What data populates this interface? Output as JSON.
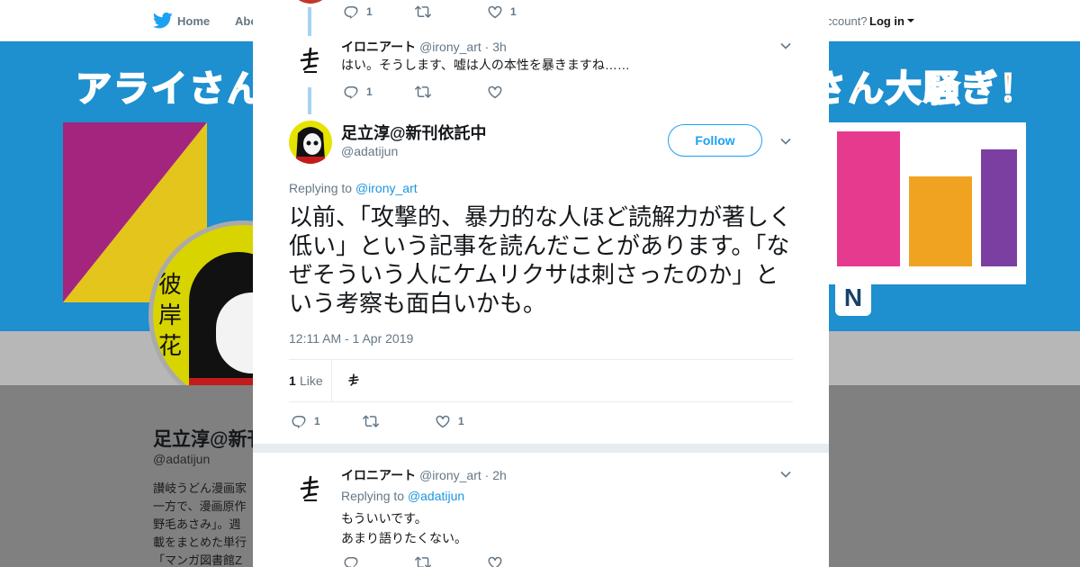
{
  "background": {
    "nav": {
      "home_label": "Home",
      "about_label": "Abo",
      "account_text": "ccount?",
      "login_label": "Log in"
    },
    "banner": {
      "title_left": "アライさんた",
      "title_right": "さん大騒ぎ！",
      "badge": "N"
    },
    "avatar_kanji": "彼岸花",
    "profile": {
      "name": "足立淳@新刊",
      "handle": "@adatijun",
      "bio": "讃岐うどん漫画家\n一方で、漫画原作\n野毛あさみ」。週\n載をまとめた単行\n「マンガ図書館Z"
    }
  },
  "modal": {
    "prev_tweet_top": {
      "reply_count": "1",
      "retweet_count": "",
      "like_count": "1"
    },
    "tweet_irony_1": {
      "name": "イロニアート",
      "handle": "@irony_art",
      "time": "· 3h",
      "text": "はい。そうします、嘘は人の本性を暴きますね……",
      "reply_count": "1",
      "retweet_count": "",
      "like_count": ""
    },
    "main_tweet": {
      "name": "足立淳@新刊依託中",
      "handle": "@adatijun",
      "follow_label": "Follow",
      "replying_prefix": "Replying to ",
      "replying_to": "@irony_art",
      "text": "以前、「攻撃的、暴力的な人ほど読解力が著しく低い」という記事を読んだことがあります。「なぜそういう人にケムリクサは刺さったのか」という考察も面白いかも。",
      "timestamp": "12:11 AM - 1 Apr 2019",
      "likes_number": "1",
      "likes_label": "Like",
      "reply_count": "1",
      "retweet_count": "",
      "like_count": "1"
    },
    "tweet_irony_2": {
      "name": "イロニアート",
      "handle": "@irony_art",
      "time": "· 2h",
      "replying_prefix": "Replying to ",
      "replying_to": "@adatijun",
      "text": "もういいです。\nあまり語りたくない。"
    }
  },
  "colors": {
    "accent": "#1da1f2",
    "thread_line": "#a5d3f3",
    "muted_text": "#657786",
    "overlay_bg": "#808080"
  },
  "icons": [
    "twitter-bird-icon",
    "close-icon",
    "reply-icon",
    "retweet-icon",
    "like-icon",
    "chevron-down-icon",
    "ironyart-logo-icon"
  ]
}
